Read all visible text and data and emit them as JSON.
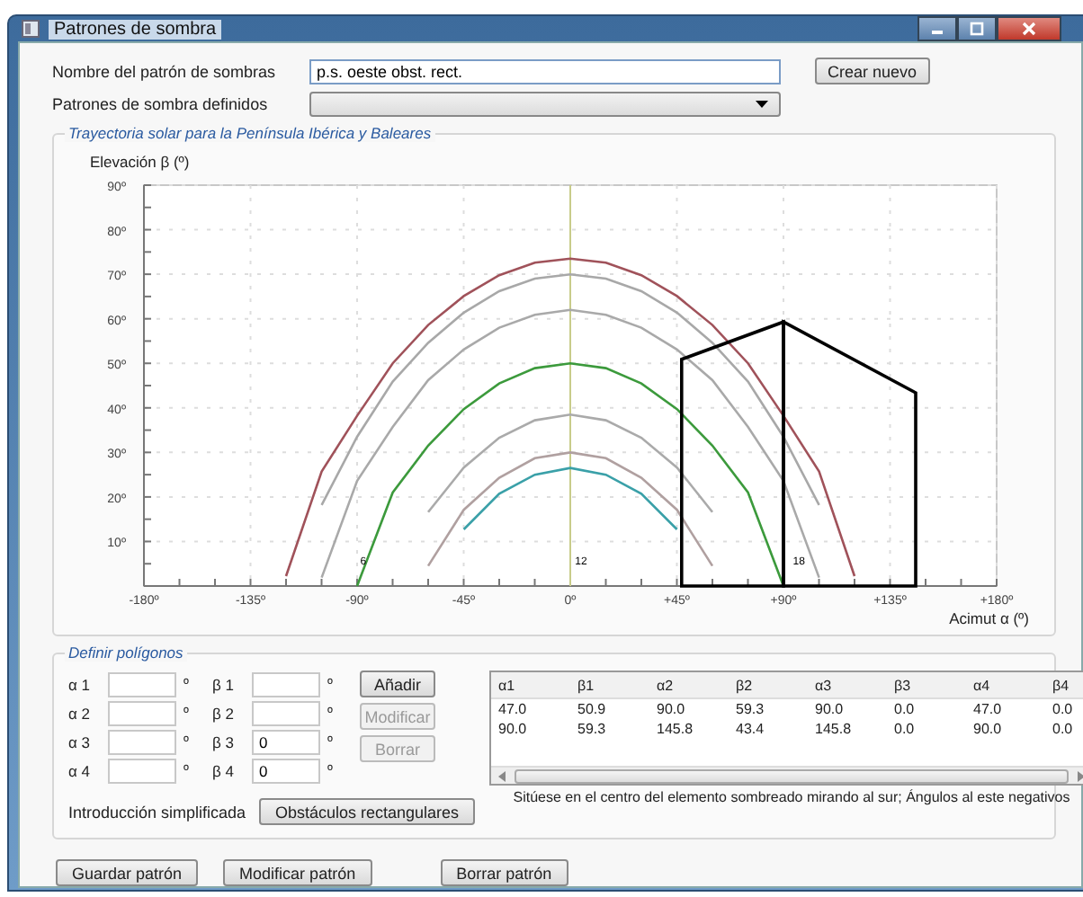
{
  "window": {
    "title": "Patrones de sombra"
  },
  "pattern_name": {
    "label": "Nombre del patrón de sombras",
    "value": "p.s. oeste obst. rect."
  },
  "create_button": {
    "label": "Crear nuevo"
  },
  "defined_patterns": {
    "label": "Patrones de sombra definidos"
  },
  "solar_chart": {
    "title": "Trayectoria solar para la Península Ibérica y Baleares",
    "chart_data": {
      "type": "line",
      "xlabel": "Acimut α (º)",
      "ylabel": "Elevación β (º)",
      "grid": true,
      "ref_lines": [
        {
          "axis": "x",
          "value": 0,
          "color": "#c8cc8a"
        }
      ],
      "xlim": [
        -180,
        180
      ],
      "ylim": [
        0,
        90
      ],
      "xticks": [
        {
          "value": -180,
          "label": "-180º"
        },
        {
          "value": -135,
          "label": "-135º"
        },
        {
          "value": -90,
          "label": "-90º"
        },
        {
          "value": -45,
          "label": "-45º"
        },
        {
          "value": 0,
          "label": "0º"
        },
        {
          "value": 45,
          "label": "+45º"
        },
        {
          "value": 90,
          "label": "+90º"
        },
        {
          "value": 135,
          "label": "+135º"
        },
        {
          "value": 180,
          "label": "+180º"
        }
      ],
      "yticks": [
        {
          "value": 10,
          "label": "10º"
        },
        {
          "value": 20,
          "label": "20º"
        },
        {
          "value": 30,
          "label": "30º"
        },
        {
          "value": 40,
          "label": "40º"
        },
        {
          "value": 50,
          "label": "50º"
        },
        {
          "value": 60,
          "label": "60º"
        },
        {
          "value": 70,
          "label": "70º"
        },
        {
          "value": 80,
          "label": "80º"
        },
        {
          "value": 90,
          "label": "90º"
        }
      ],
      "x": [
        -120,
        -105,
        -90,
        -75,
        -60,
        -45,
        -30,
        -15,
        0,
        15,
        30,
        45,
        60,
        75,
        90,
        105,
        120
      ],
      "series": [
        {
          "color": "#a0525a",
          "values": [
            2.2,
            25.7,
            38.2,
            50.0,
            58.6,
            65.1,
            69.8,
            72.6,
            73.5,
            72.6,
            69.8,
            65.1,
            58.6,
            50.0,
            38.2,
            25.7,
            2.2
          ]
        },
        {
          "color": "#a8a8a8",
          "values": [
            null,
            18.2,
            33.5,
            45.9,
            54.6,
            61.4,
            66.2,
            69.0,
            70,
            69.0,
            66.2,
            61.4,
            54.6,
            45.9,
            33.5,
            18.2,
            null
          ]
        },
        {
          "color": "#a9a9a9",
          "values": [
            null,
            1.9,
            23.6,
            35.7,
            46.2,
            53.1,
            58.0,
            60.9,
            62,
            60.9,
            58.0,
            53.1,
            46.2,
            35.7,
            23.6,
            1.9,
            null
          ]
        },
        {
          "color": "#3c9a3c",
          "values": [
            null,
            null,
            0,
            21.0,
            31.5,
            39.7,
            45.5,
            48.9,
            50,
            48.9,
            45.5,
            39.7,
            31.5,
            21.0,
            0,
            null,
            null
          ]
        },
        {
          "color": "#aaaaaa",
          "values": [
            null,
            null,
            null,
            null,
            16.6,
            26.6,
            33.3,
            37.2,
            38.5,
            37.2,
            33.3,
            26.6,
            16.6,
            null,
            null,
            null,
            null
          ]
        },
        {
          "color": "#b0a0a0",
          "values": [
            null,
            null,
            null,
            null,
            4.5,
            17.1,
            24.3,
            28.7,
            30,
            28.7,
            24.3,
            17.1,
            4.5,
            null,
            null,
            null,
            null
          ]
        },
        {
          "color": "#3aa0a8",
          "values": [
            null,
            null,
            null,
            null,
            null,
            12.7,
            20.7,
            25.0,
            26.5,
            25.0,
            20.7,
            12.7,
            null,
            null,
            null,
            null,
            null
          ]
        }
      ],
      "annotations": [
        "6",
        "12",
        "18"
      ]
    }
  },
  "polygons": {
    "title": "Definir polígonos",
    "alpha_fields": [
      {
        "label": "α 1",
        "unit": "º"
      },
      {
        "label": "α 2",
        "unit": "º"
      },
      {
        "label": "α 3",
        "unit": "º"
      },
      {
        "label": "α 4",
        "unit": "º"
      }
    ],
    "beta_fields": [
      {
        "label": "β 1",
        "unit": "º"
      },
      {
        "label": "β 2",
        "unit": "º"
      },
      {
        "label": "β 3",
        "value": "0",
        "unit": "º"
      },
      {
        "label": "β 4",
        "value": "0",
        "unit": "º"
      }
    ],
    "buttons": [
      {
        "label": "Añadir",
        "disabled": false
      },
      {
        "label": "Modificar",
        "disabled": true
      },
      {
        "label": "Borrar",
        "disabled": true
      }
    ],
    "simplified": {
      "label": "Introducción simplificada",
      "button": "Obstáculos rectangulares"
    },
    "table": {
      "columns": [
        "α1",
        "β1",
        "α2",
        "β2",
        "α3",
        "β3",
        "α4",
        "β4"
      ],
      "rows": [
        [
          "47.0",
          "50.9",
          "90.0",
          "59.3",
          "90.0",
          "0.0",
          "47.0",
          "0.0"
        ],
        [
          "90.0",
          "59.3",
          "145.8",
          "43.4",
          "145.8",
          "0.0",
          "90.0",
          "0.0"
        ]
      ]
    },
    "note": "Sitúese en el centro del elemento sombreado mirando al sur; Ángulos al este negativos"
  },
  "footer_buttons": [
    {
      "label": "Guardar patrón"
    },
    {
      "label": "Modificar patrón"
    },
    {
      "label": "Borrar patrón"
    }
  ]
}
